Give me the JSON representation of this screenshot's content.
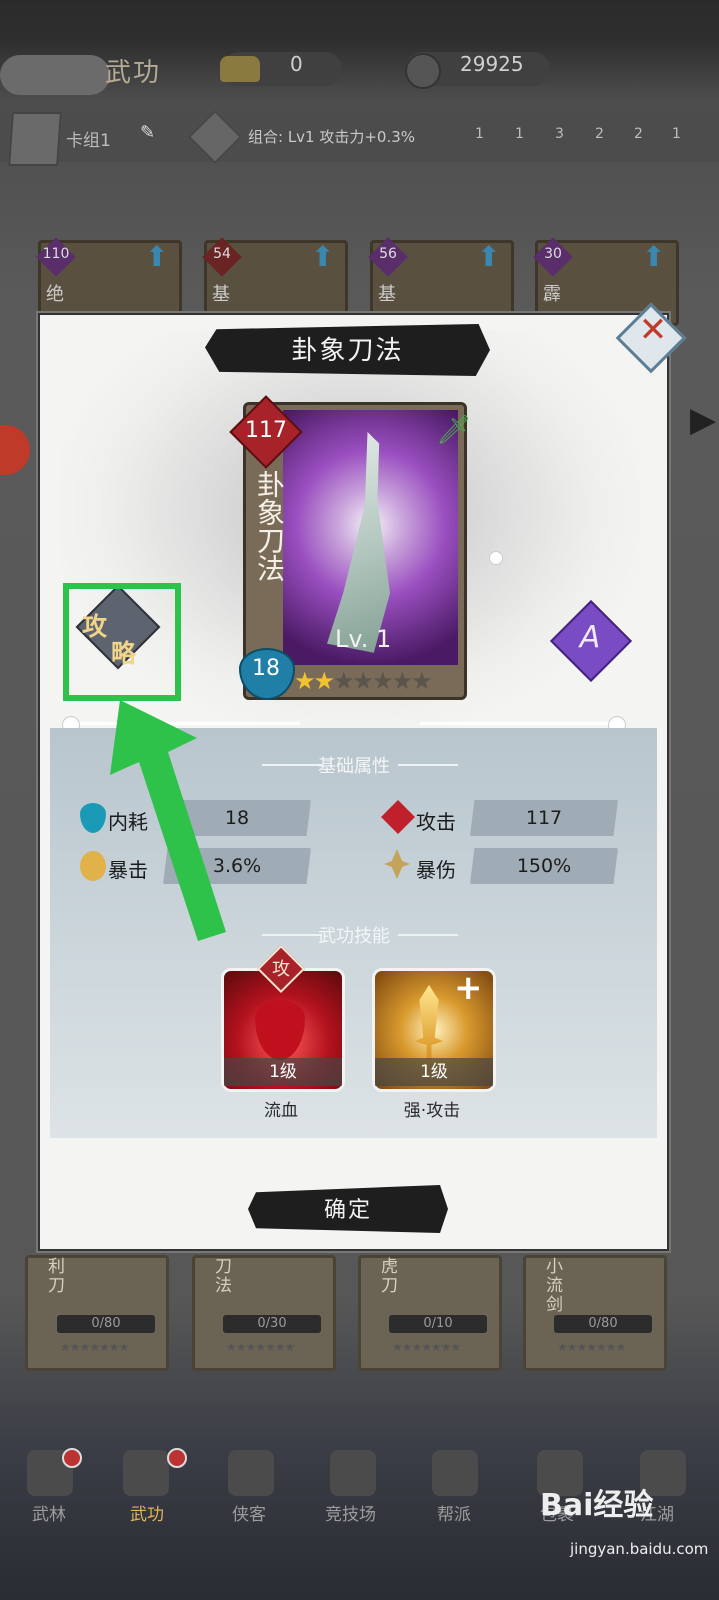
{
  "screen": {
    "title": "武功"
  },
  "currency": {
    "gold": "0",
    "coins": "29925"
  },
  "deck": {
    "label": "卡组1",
    "combo": "组合: Lv1 攻击力+0.3%"
  },
  "combo_items": [
    "1",
    "1",
    "3",
    "2",
    "2",
    "1"
  ],
  "bg_cards": [
    {
      "cost": "110",
      "name": "绝"
    },
    {
      "cost": "54",
      "name": "基"
    },
    {
      "cost": "56",
      "name": "基"
    },
    {
      "cost": "30",
      "name": "霹"
    }
  ],
  "bottom_cards": [
    {
      "name": "利刀",
      "progress": "0/80"
    },
    {
      "name": "刀法",
      "progress": "0/30"
    },
    {
      "name": "虎刀",
      "progress": "0/10"
    },
    {
      "name": "小流剑",
      "progress": "0/80"
    }
  ],
  "modal": {
    "title": "卦象刀法",
    "card": {
      "cost": "117",
      "name": "卦象刀法",
      "level": "Lv. 1",
      "energy": "18",
      "stars_filled": 2,
      "stars_total": 7,
      "rarity": "A"
    },
    "guide": {
      "line1": "攻",
      "line2": "略"
    },
    "sections": {
      "base": "基础属性",
      "skills": "武功技能"
    },
    "stats": {
      "inner_cost": {
        "label": "内耗",
        "value": "18"
      },
      "attack": {
        "label": "攻击",
        "value": "117"
      },
      "crit": {
        "label": "暴击",
        "value": "3.6%"
      },
      "crit_dmg": {
        "label": "暴伤",
        "value": "150%"
      }
    },
    "skills": [
      {
        "tag": "攻",
        "level": "1级",
        "name": "流血"
      },
      {
        "level": "1级",
        "name": "强·攻击"
      }
    ],
    "confirm": "确定"
  },
  "nav": [
    "武林",
    "武功",
    "侠客",
    "竞技场",
    "帮派",
    "包裹",
    "江湖"
  ],
  "watermark": {
    "brand": "Bai经验",
    "url": "jingyan.baidu.com"
  },
  "colors": {
    "highlight": "#2ec24a",
    "attack_red": "#a8222a",
    "energy_blue": "#1f7fa6",
    "rarity_purple": "#7a4cc4"
  }
}
